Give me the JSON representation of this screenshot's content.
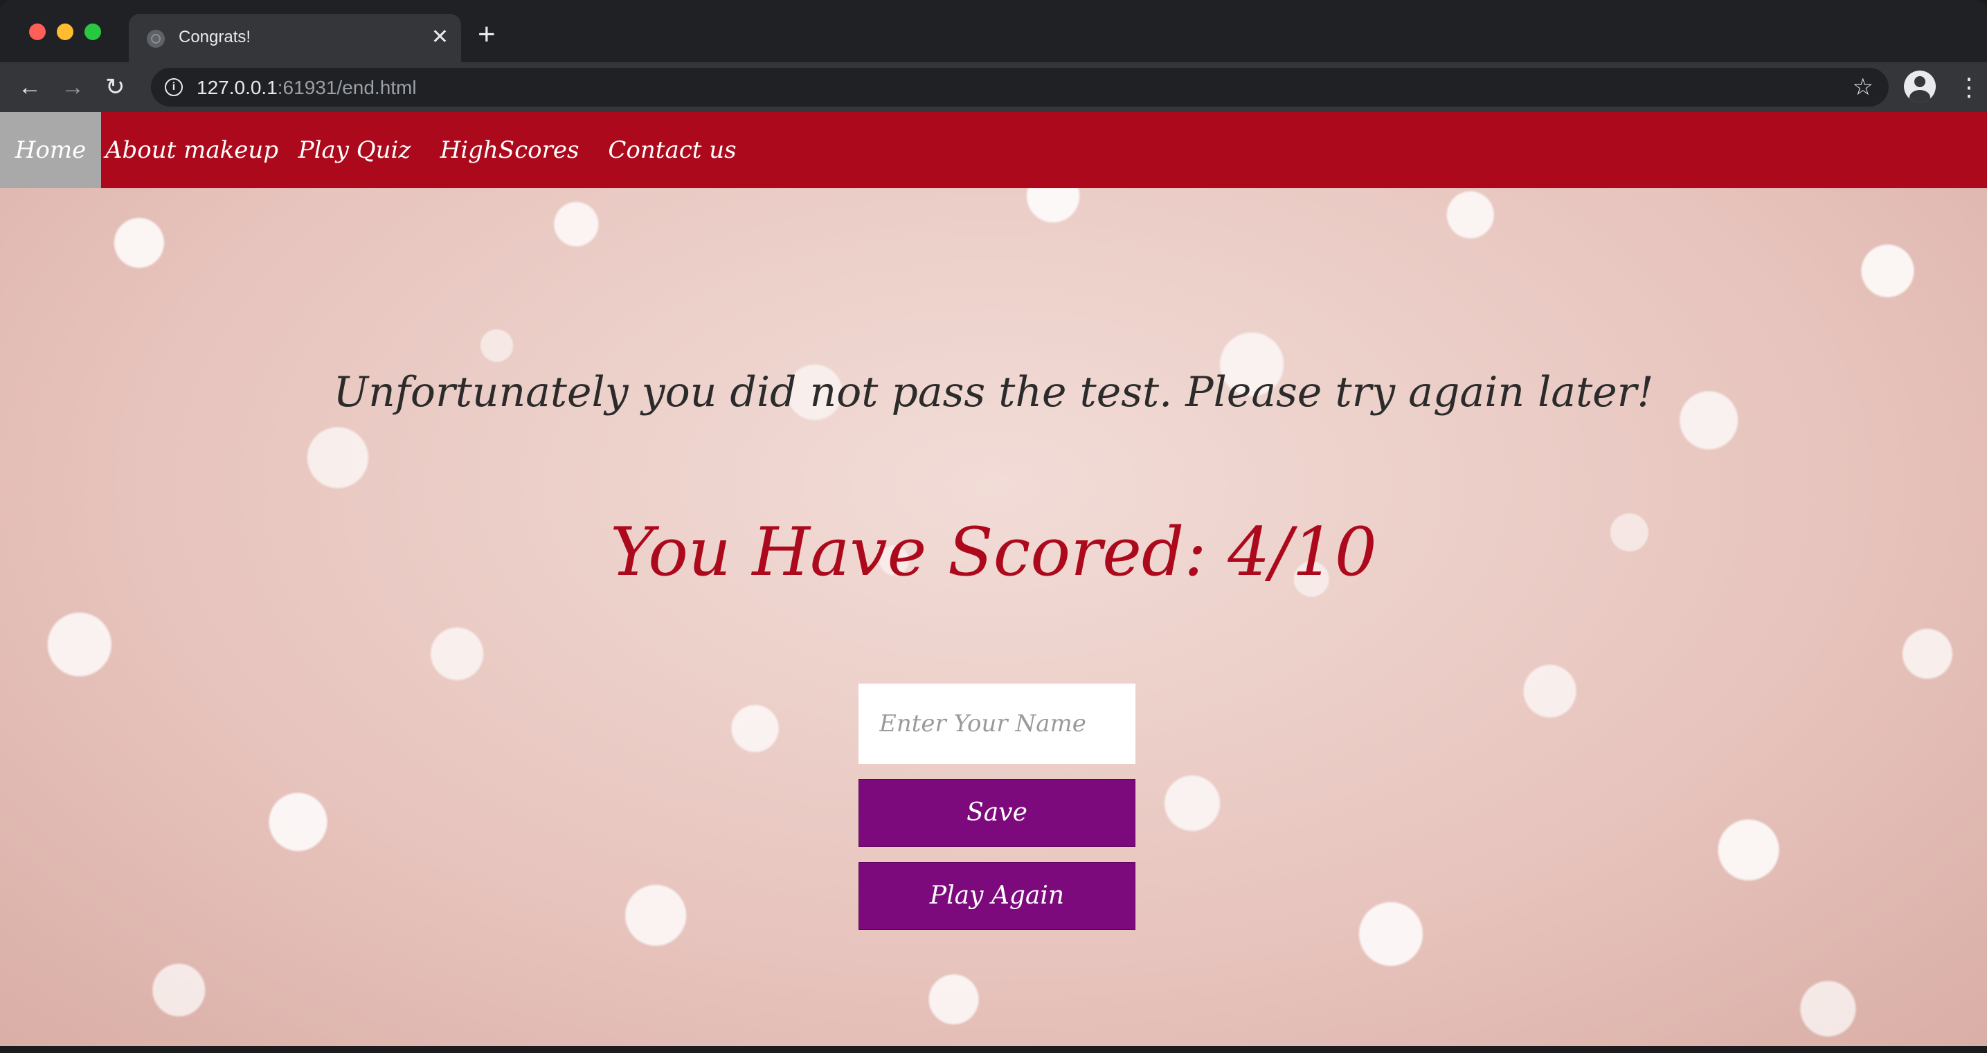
{
  "browser": {
    "tab": {
      "title": "Congrats!",
      "close_glyph": "✕"
    },
    "new_tab_glyph": "+",
    "nav": {
      "back_glyph": "←",
      "forward_glyph": "→",
      "reload_glyph": "↻"
    },
    "address": {
      "host": "127.0.0.1",
      "rest": ":61931/end.html",
      "info_glyph": "i"
    },
    "star_glyph": "☆",
    "menu_glyph": "⋮",
    "colors": {
      "tabstrip": "#202124",
      "toolbar": "#35363a"
    }
  },
  "site": {
    "nav": {
      "items": [
        {
          "label": "Home"
        },
        {
          "label": "About makeup"
        },
        {
          "label": "Play Quiz"
        },
        {
          "label": "HighScores"
        },
        {
          "label": "Contact us"
        }
      ],
      "active_index": 0
    },
    "result": {
      "message": "Unfortunately you did not pass the test. Please try again later!",
      "score_label": "You Have Scored: 4/10"
    },
    "form": {
      "name_placeholder": "Enter Your Name",
      "name_value": "",
      "save_label": "Save",
      "play_again_label": "Play Again"
    },
    "colors": {
      "nav_background": "#ac0a1c",
      "nav_active": "#a9a9a9",
      "score_text": "#ac0a1c",
      "button_background": "#7d0a7d",
      "page_background": "#e9c8c2"
    }
  },
  "icons": {
    "tab_favicon": "globe-icon",
    "info": "info-icon",
    "bookmark": "star-icon",
    "profile": "account-circle-icon",
    "menu": "kebab-menu-icon"
  }
}
